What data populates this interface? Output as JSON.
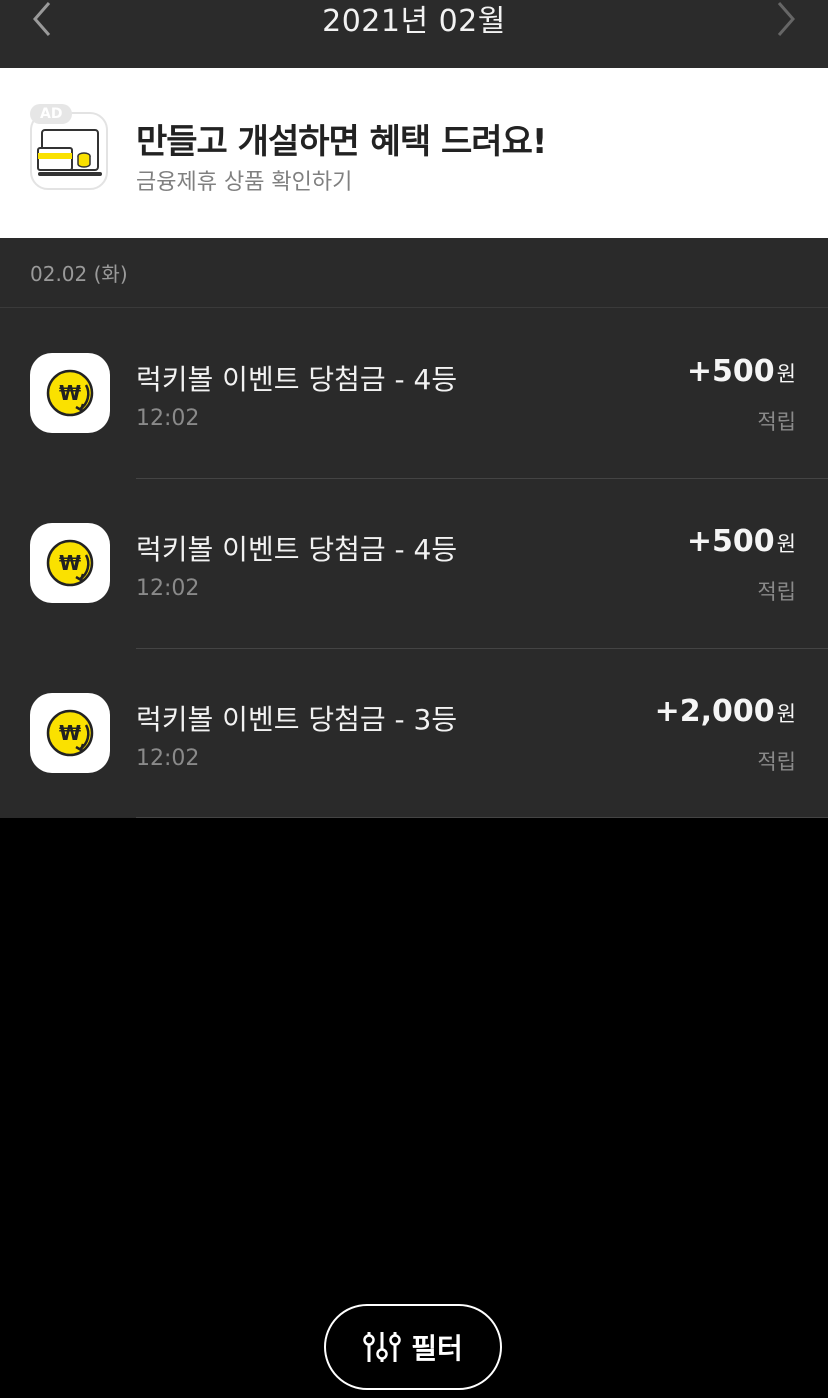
{
  "header": {
    "title": "2021년 02월"
  },
  "ad": {
    "badge": "AD",
    "title": "만들고 개설하면 혜택 드려요!",
    "subtitle": "금융제휴 상품 확인하기"
  },
  "date_label": "02.02 (화)",
  "transactions": [
    {
      "label": "럭키볼 이벤트 당첨금 - 4등",
      "time": "12:02",
      "amount": "+500",
      "unit": "원",
      "type": "적립"
    },
    {
      "label": "럭키볼 이벤트 당첨금 - 4등",
      "time": "12:02",
      "amount": "+500",
      "unit": "원",
      "type": "적립"
    },
    {
      "label": "럭키볼 이벤트 당첨금 - 3등",
      "time": "12:02",
      "amount": "+2,000",
      "unit": "원",
      "type": "적립"
    }
  ],
  "filter": {
    "label": "필터"
  },
  "colors": {
    "accent": "#fae100",
    "background": "#000000",
    "panel": "#2a2a2a"
  }
}
